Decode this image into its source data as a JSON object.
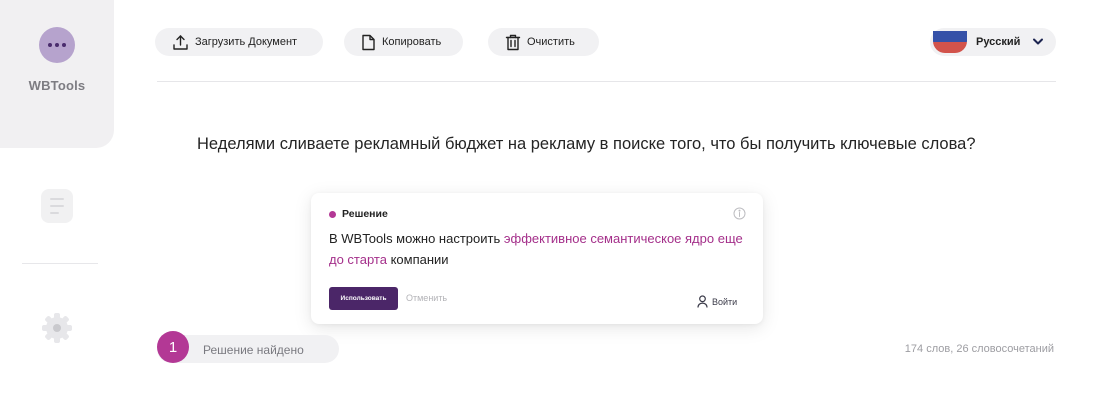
{
  "sidebar": {
    "app_name": "WBTools",
    "app_icon": "more-dots-icon",
    "items": [
      {
        "icon": "document-icon"
      },
      {
        "icon": "gear-icon"
      }
    ]
  },
  "toolbar": {
    "upload_label": "Загрузить Документ",
    "copy_label": "Копировать",
    "clear_label": "Очистить",
    "language": "Русский"
  },
  "editor": {
    "text": "Неделями сливаете рекламный бюджет на рекламу в поиске того, что бы получить ключевые слова?"
  },
  "suggestion": {
    "title": "Решение",
    "body_prefix": "В WBTools можно настроить ",
    "body_highlight": "эффективное семантическое ядро еще до старта",
    "body_suffix": " компании",
    "use_label": "Использовать",
    "cancel_label": "Отменить",
    "login_label": "Войти",
    "accent": "#b33895"
  },
  "footer": {
    "found_count": "1",
    "found_label": "Решение найдено",
    "stats": "174 слов, 26 словосочетаний"
  },
  "colors": {
    "accent": "#b33895",
    "primary_button": "#4b2668",
    "app_icon_bg": "#b6a3cd"
  }
}
